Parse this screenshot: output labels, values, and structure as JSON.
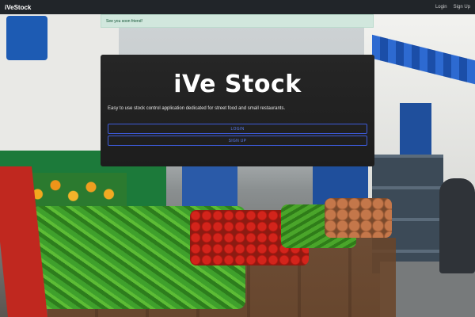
{
  "navbar": {
    "brand": "iVeStock",
    "links": [
      "Login",
      "Sign Up"
    ]
  },
  "alert": {
    "message": "See you soon friend!"
  },
  "hero": {
    "title": "iVe Stock",
    "subtitle": "Easy to use stock control application dedicated for street food and small restaurants.",
    "login_button": "LOGIN",
    "signup_button": "SIGN UP"
  },
  "colors": {
    "navbar_bg": "#212529",
    "alert_bg": "#d1e7dd",
    "button_outline": "#3d5bd9"
  }
}
